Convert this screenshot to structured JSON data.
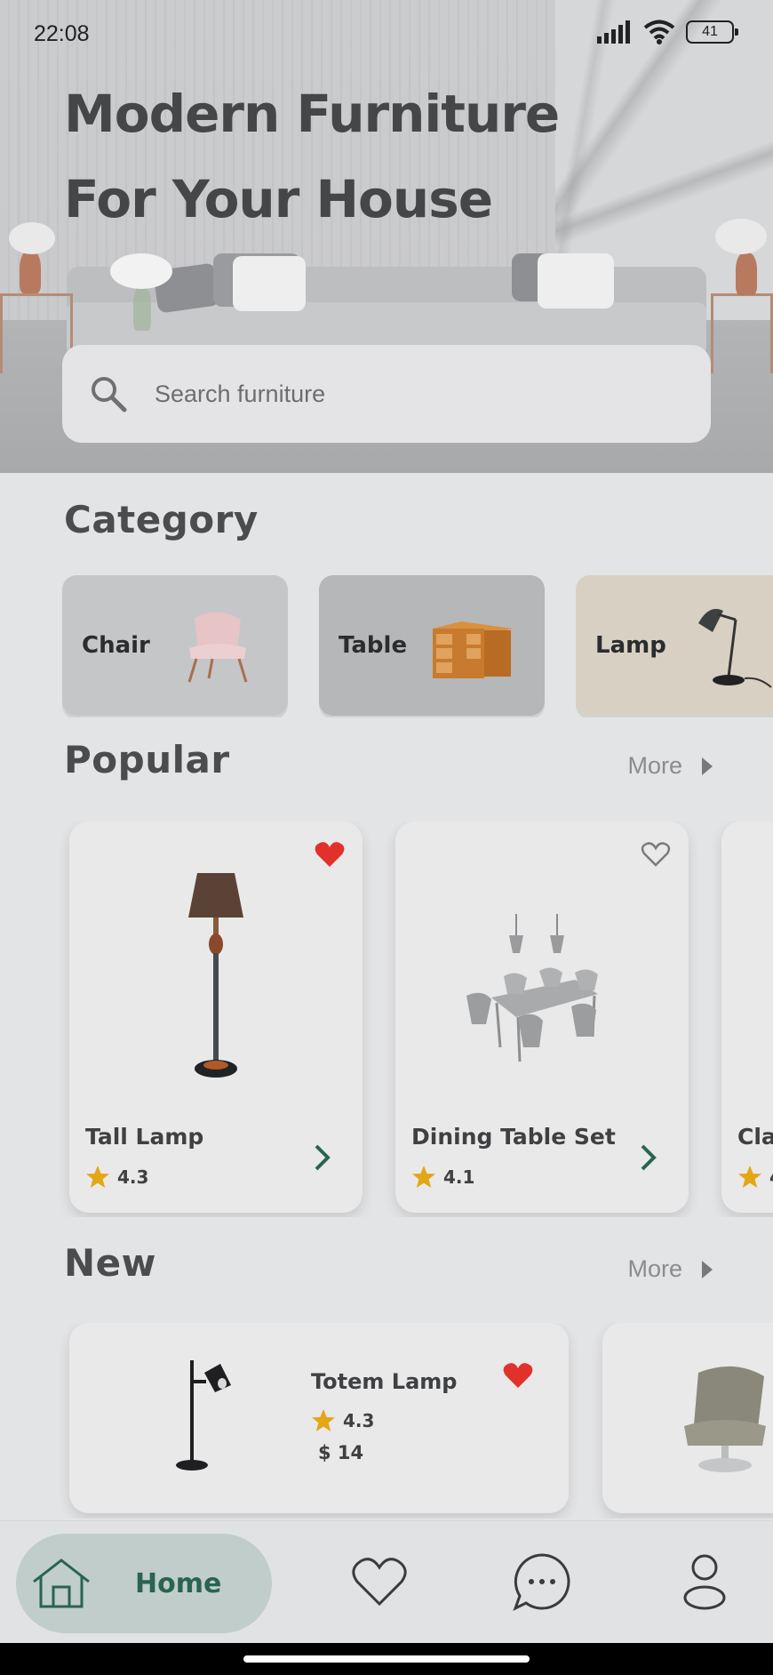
{
  "status_bar": {
    "time": "22:08",
    "battery": "41"
  },
  "hero": {
    "title_line1": "Modern Furniture",
    "title_line2": "For Your House",
    "search_placeholder": "Search furniture"
  },
  "category": {
    "title": "Category",
    "items": [
      {
        "label": "Chair",
        "bg": "#c5c6c8"
      },
      {
        "label": "Table",
        "bg": "#b6b7b9"
      },
      {
        "label": "Lamp",
        "bg": "#d8d0c3"
      }
    ]
  },
  "popular": {
    "title": "Popular",
    "more_label": "More",
    "items": [
      {
        "name": "Tall Lamp",
        "rating": "4.3",
        "favorite": true
      },
      {
        "name": "Dining Table Set",
        "rating": "4.1",
        "favorite": false
      },
      {
        "name": "Cla",
        "rating": "4",
        "favorite": false
      }
    ]
  },
  "new": {
    "title": "New",
    "more_label": "More",
    "items": [
      {
        "name": "Totem Lamp",
        "rating": "4.3",
        "price": "$ 14",
        "favorite": true
      }
    ]
  },
  "bottom_nav": {
    "home_label": "Home",
    "items": [
      "home-icon",
      "heart-icon",
      "chat-icon",
      "profile-icon"
    ]
  },
  "colors": {
    "accent_green": "#29644f",
    "heart_red": "#e0322b",
    "star_gold": "#e3a615",
    "home_pill": "#c0cdca"
  }
}
